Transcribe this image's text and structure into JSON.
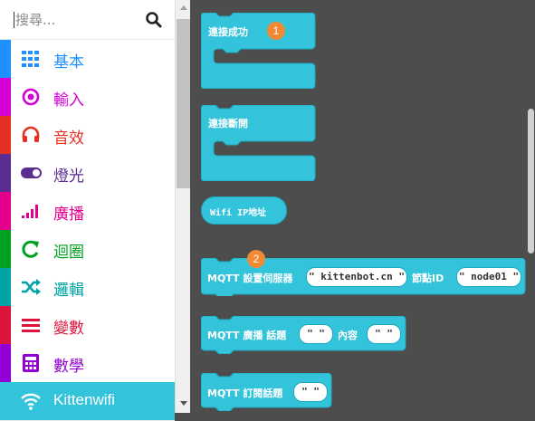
{
  "search": {
    "placeholder": "搜尋..."
  },
  "categories": [
    {
      "label": "基本",
      "color": "#1e90ff",
      "icon": "grid-icon"
    },
    {
      "label": "輸入",
      "color": "#d400d4",
      "icon": "target-icon"
    },
    {
      "label": "音效",
      "color": "#e63022",
      "icon": "headphones-icon"
    },
    {
      "label": "燈光",
      "color": "#5c2d91",
      "icon": "toggle-icon"
    },
    {
      "label": "廣播",
      "color": "#e3008c",
      "icon": "signal-bars-icon"
    },
    {
      "label": "迴圈",
      "color": "#00a020",
      "icon": "loop-icon"
    },
    {
      "label": "邏輯",
      "color": "#00a4a6",
      "icon": "shuffle-icon"
    },
    {
      "label": "變數",
      "color": "#dc143c",
      "icon": "list-icon"
    },
    {
      "label": "數學",
      "color": "#9400d3",
      "icon": "calculator-icon"
    },
    {
      "label": "Kittenwifi",
      "color": "#33c4dc",
      "icon": "wifi-icon"
    }
  ],
  "blocks": {
    "connected": {
      "label": "連接成功",
      "badge": "1"
    },
    "disconnected": {
      "label": "連接斷開"
    },
    "wifi_ip": {
      "label": "Wifi IP地址"
    },
    "mqtt_setup": {
      "prefix": "MQTT 設置伺服器",
      "server": "\" kittenbot.cn \"",
      "node_label": "節點ID",
      "node": "\" node01 \"",
      "badge": "2"
    },
    "mqtt_publish": {
      "prefix": "MQTT 廣播 話題",
      "topic": "\"   \"",
      "content_label": "內容",
      "content": "\"   \""
    },
    "mqtt_subscribe": {
      "prefix": "MQTT 訂閱話題",
      "topic": "\"   \""
    }
  },
  "colors": {
    "block": "#33c4dc",
    "block_dark": "#1ea9bf",
    "workspace": "#4d4d4d"
  }
}
